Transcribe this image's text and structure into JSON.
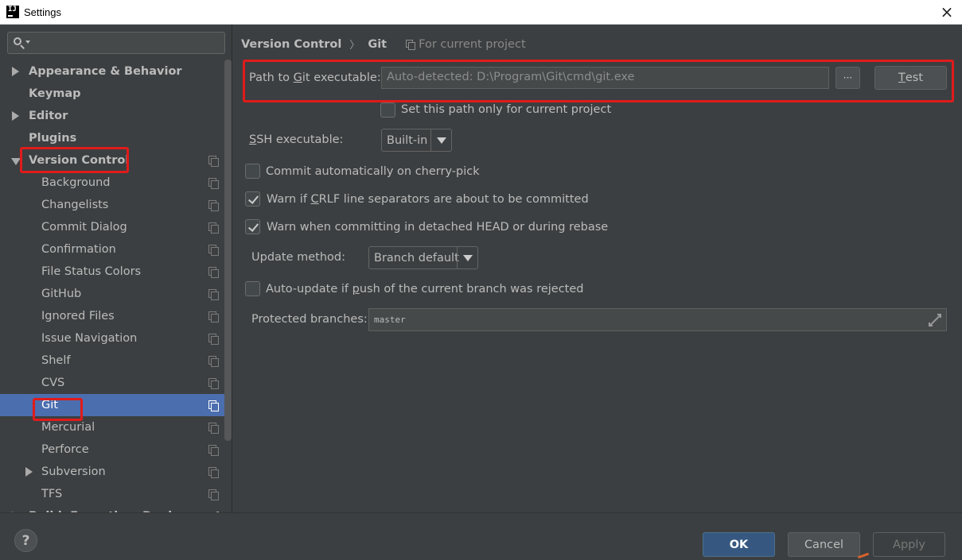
{
  "window": {
    "title": "Settings",
    "app_icon_text": "IJ",
    "close_glyph": "×"
  },
  "search": {
    "value": "",
    "placeholder": ""
  },
  "sidebar": {
    "items": [
      {
        "label": "Appearance & Behavior",
        "level": 0,
        "bold": true,
        "arrow": "right"
      },
      {
        "label": "Keymap",
        "level": 0,
        "bold": true
      },
      {
        "label": "Editor",
        "level": 0,
        "bold": true,
        "arrow": "right"
      },
      {
        "label": "Plugins",
        "level": 0,
        "bold": true
      },
      {
        "label": "Version Control",
        "level": 0,
        "bold": true,
        "arrow": "down",
        "project_icon": true
      },
      {
        "label": "Background",
        "level": 1,
        "project_icon": true
      },
      {
        "label": "Changelists",
        "level": 1,
        "project_icon": true
      },
      {
        "label": "Commit Dialog",
        "level": 1,
        "project_icon": true
      },
      {
        "label": "Confirmation",
        "level": 1,
        "project_icon": true
      },
      {
        "label": "File Status Colors",
        "level": 1,
        "project_icon": true
      },
      {
        "label": "GitHub",
        "level": 1,
        "project_icon": true
      },
      {
        "label": "Ignored Files",
        "level": 1,
        "project_icon": true
      },
      {
        "label": "Issue Navigation",
        "level": 1,
        "project_icon": true
      },
      {
        "label": "Shelf",
        "level": 1,
        "project_icon": true
      },
      {
        "label": "CVS",
        "level": 1,
        "project_icon": true
      },
      {
        "label": "Git",
        "level": 1,
        "project_icon": true,
        "selected": true
      },
      {
        "label": "Mercurial",
        "level": 1,
        "project_icon": true
      },
      {
        "label": "Perforce",
        "level": 1,
        "project_icon": true
      },
      {
        "label": "Subversion",
        "level": 1,
        "project_icon": true,
        "arrow": "right"
      },
      {
        "label": "TFS",
        "level": 1,
        "project_icon": true
      },
      {
        "label": "Build, Execution, Deployment",
        "level": 0,
        "bold": true,
        "arrow": "right"
      }
    ]
  },
  "breadcrumb": {
    "parent": "Version Control",
    "separator": "〉",
    "current": "Git",
    "scope": "For current project"
  },
  "git": {
    "path_label_pre": "Path to ",
    "path_label_mnemonic": "G",
    "path_label_post": "it executable:",
    "path_value": "Auto-detected: D:\\Program\\Git\\cmd\\git.exe",
    "browse_label": "···",
    "test_mnemonic": "T",
    "test_rest": "est",
    "set_path_label": "Set this path only for current project",
    "set_path_checked": false,
    "ssh_label_mnemonic": "S",
    "ssh_label_rest": "SH executable:",
    "ssh_value": "Built-in",
    "cherry_pick_label": "Commit automatically on cherry-pick",
    "cherry_pick_checked": false,
    "crlf_label_pre": "Warn if ",
    "crlf_label_mnemonic": "C",
    "crlf_label_post": "RLF line separators are about to be committed",
    "crlf_checked": true,
    "detached_label": "Warn when committing in detached HEAD or during rebase",
    "detached_checked": true,
    "update_label": "Update method:",
    "update_value": "Branch default",
    "autoupdate_label_pre": "Auto-update if ",
    "autoupdate_label_mnemonic": "p",
    "autoupdate_label_post": "ush of the current branch was rejected",
    "autoupdate_checked": false,
    "protected_label": "Protected branches:",
    "protected_value": "master"
  },
  "footer": {
    "help_label": "?",
    "ok_label": "OK",
    "cancel_label": "Cancel",
    "apply_label": "Apply"
  },
  "colors": {
    "background": "#3c3f41",
    "selection": "#4b6eaf",
    "primary_button": "#365880",
    "highlight_box": "#e01b1b"
  }
}
